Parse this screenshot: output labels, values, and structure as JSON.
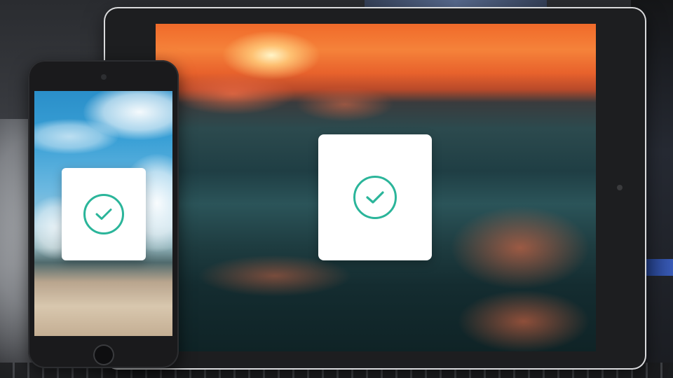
{
  "scene": {
    "accent_color": "#2bb59a",
    "tablet": {
      "wallpaper": "ocean-sunset",
      "card_icon": "check-circle-icon"
    },
    "phone": {
      "wallpaper": "beach-sky",
      "card_icon": "check-circle-icon"
    }
  }
}
